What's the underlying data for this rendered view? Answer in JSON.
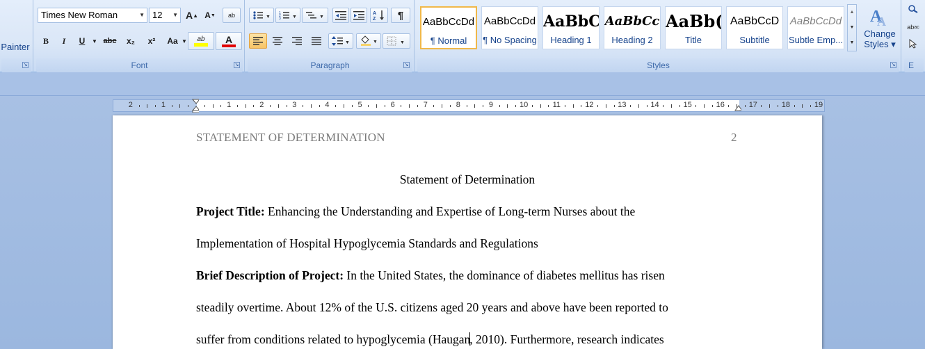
{
  "clipboard": {
    "format_painter_label": "Painter"
  },
  "font": {
    "group_label": "Font",
    "font_name": "Times New Roman",
    "font_size": "12",
    "grow_font": "A",
    "shrink_font": "A",
    "clear_format": "ab",
    "bold": "B",
    "italic": "I",
    "underline": "U",
    "strikethrough": "abc",
    "subscript": "x₂",
    "superscript": "x²",
    "change_case": "Aa",
    "highlight": "ab",
    "font_color": "A",
    "highlight_color": "#ffff00",
    "font_color_value": "#e00000"
  },
  "paragraph": {
    "group_label": "Paragraph"
  },
  "styles": {
    "group_label": "Styles",
    "items": [
      {
        "sample": "AaBbCcDd",
        "name": "¶ Normal"
      },
      {
        "sample": "AaBbCcDd",
        "name": "¶ No Spacing"
      },
      {
        "sample": "AaBbC(",
        "name": "Heading 1"
      },
      {
        "sample": "AaBbCc",
        "name": "Heading 2"
      },
      {
        "sample": "AaBb(",
        "name": "Title"
      },
      {
        "sample": "AaBbCcD",
        "name": "Subtitle"
      },
      {
        "sample": "AaBbCcDd",
        "name": "Subtle Emp..."
      }
    ],
    "change_styles_label": "Change",
    "change_styles_label2": "Styles ▾"
  },
  "editing": {
    "group_label": "E"
  },
  "ruler": {
    "labels": [
      "2",
      "1",
      "",
      "1",
      "2",
      "3",
      "4",
      "5",
      "6",
      "7",
      "8",
      "9",
      "10",
      "11",
      "12",
      "13",
      "14",
      "15",
      "16",
      "17",
      "18",
      "19"
    ]
  },
  "document": {
    "running_head": "STATEMENT OF DETERMINATION",
    "page_number": "2",
    "title": "Statement of Determination",
    "project_title_label": "Project Title:",
    "project_title_text": " Enhancing the Understanding and Expertise of Long-term Nurses about the",
    "project_title_line2": "Implementation of Hospital Hypoglycemia Standards and Regulations",
    "description_label": "Brief Description  of Project:",
    "description_text": " In the United States, the dominance of diabetes mellitus has risen",
    "line_4": "steadily overtime. About 12% of the U.S. citizens aged 20 years and above have been reported to",
    "line_5a": "suffer from conditions related to hypoglycemia (Haugan",
    "line_5b": ", 2010). Furthermore, research indicates"
  }
}
